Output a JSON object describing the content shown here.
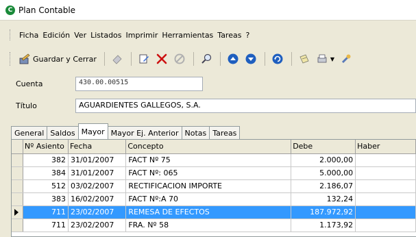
{
  "window": {
    "title": "Plan Contable",
    "app_icon_letter": "C"
  },
  "menu": [
    "Ficha",
    "Edición",
    "Ver",
    "Listados",
    "Imprimir",
    "Herramientas",
    "Tareas",
    "?"
  ],
  "toolbar": {
    "save_close_label": "Guardar y Cerrar"
  },
  "form": {
    "cuenta_label": "Cuenta",
    "cuenta_value": "430.00.00515",
    "titulo_label": "Título",
    "titulo_value": "AGUARDIENTES GALLEGOS, S.A."
  },
  "tabs": [
    "General",
    "Saldos",
    "Mayor",
    "Mayor Ej. Anterior",
    "Notas",
    "Tareas"
  ],
  "active_tab": "Mayor",
  "grid": {
    "columns": [
      "Nº Asiento",
      "Fecha",
      "Concepto",
      "Debe",
      "Haber"
    ],
    "rows": [
      [
        "382",
        "31/01/2007",
        "FACT Nº 75",
        "2.000,00",
        ""
      ],
      [
        "384",
        "31/01/2007",
        "FACT Nº: 065",
        "5.000,00",
        ""
      ],
      [
        "512",
        "03/02/2007",
        "RECTIFICACION IMPORTE",
        "2.186,07",
        ""
      ],
      [
        "383",
        "16/02/2007",
        "FACT Nº:A 70",
        "132,24",
        ""
      ],
      [
        "711",
        "23/02/2007",
        "REMESA DE EFECTOS",
        "187.972,92",
        ""
      ],
      [
        "711",
        "23/02/2007",
        "FRA. Nº 58",
        "1.173,92",
        ""
      ]
    ],
    "selected_row": 4
  },
  "colors": {
    "selection": "#3399ff",
    "app_icon": "#1a8a3a",
    "delete_red": "#cc1111",
    "nav_blue": "#1f5fbf"
  }
}
